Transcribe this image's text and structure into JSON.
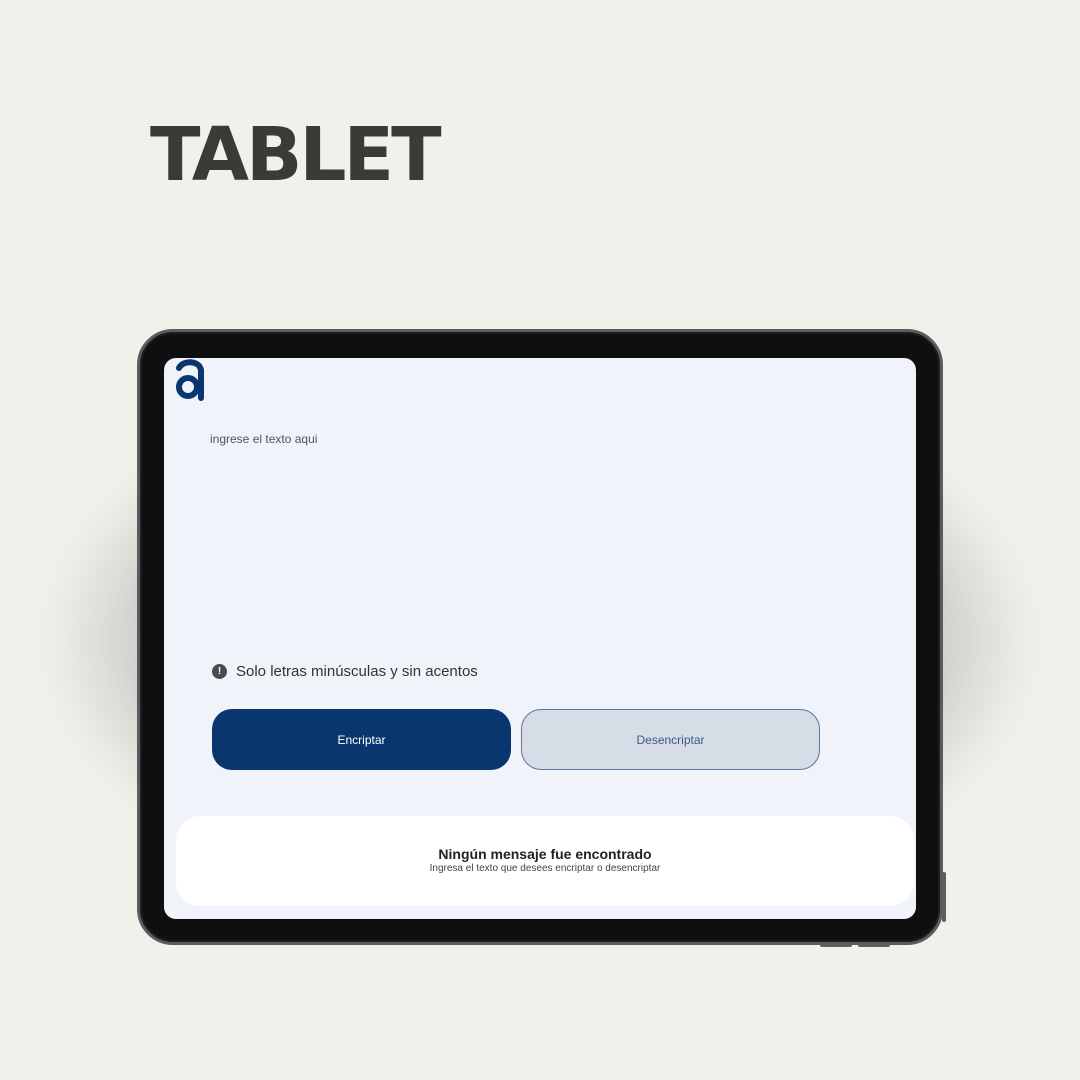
{
  "page": {
    "heading": "TABLET"
  },
  "app": {
    "logo_letter": "a",
    "input": {
      "placeholder": "ingrese el texto aqui",
      "value": ""
    },
    "hint": {
      "icon": "exclamation-circle-icon",
      "text": "Solo letras minúsculas y sin acentos"
    },
    "buttons": {
      "encrypt_label": "Encriptar",
      "decrypt_label": "Desencriptar"
    },
    "result": {
      "title": "Ningún mensaje fue encontrado",
      "subtitle": "Ingresa el texto que desees encriptar o desencriptar"
    }
  },
  "colors": {
    "page_background": "#f1f0eb",
    "screen_background": "#f0f3fa",
    "primary": "#0a3670",
    "secondary_fill": "#d7dde7",
    "secondary_border": "#5b77a0",
    "heading_text": "#3a3a37"
  }
}
